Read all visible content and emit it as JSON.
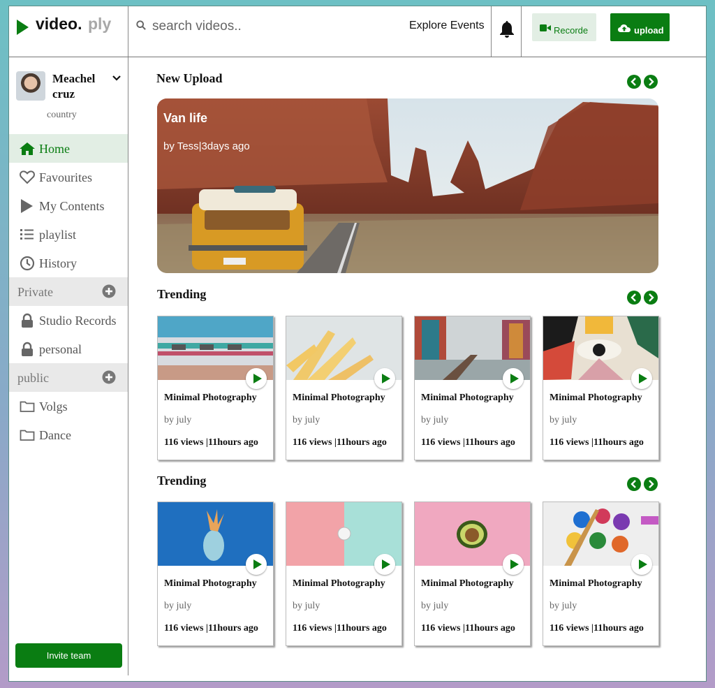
{
  "brand": {
    "name": "video.",
    "suffix": "ply"
  },
  "search": {
    "placeholder": "search videos.."
  },
  "header": {
    "explore_label": "Explore Events",
    "record_label": "Recorde",
    "upload_label": "upload"
  },
  "profile": {
    "name": "Meachel cruz",
    "location": "country"
  },
  "sidebar": {
    "items": [
      {
        "label": "Home",
        "icon": "home-icon"
      },
      {
        "label": "Favourites",
        "icon": "heart-icon"
      },
      {
        "label": "My Contents",
        "icon": "play-icon"
      },
      {
        "label": "playlist",
        "icon": "list-icon"
      },
      {
        "label": "History",
        "icon": "clock-icon"
      }
    ],
    "private_label": "Private",
    "private_items": [
      {
        "label": "Studio Records",
        "icon": "lock-icon"
      },
      {
        "label": "personal",
        "icon": "lock-icon"
      }
    ],
    "public_label": "public",
    "public_items": [
      {
        "label": "Volgs",
        "icon": "folder-icon"
      },
      {
        "label": "Dance",
        "icon": "folder-icon"
      }
    ],
    "invite_label": "Invite team"
  },
  "sections": {
    "new_upload": "New Upload",
    "trending_1": "Trending",
    "trending_2": "Trending"
  },
  "hero": {
    "title": "Van life",
    "subtitle": "by Tess|3days ago"
  },
  "trending_1": [
    {
      "title": "Minimal Photography",
      "by": "by july",
      "meta": "116 views |11hours ago"
    },
    {
      "title": "Minimal Photography",
      "by": "by july",
      "meta": "116 views |11hours ago"
    },
    {
      "title": "Minimal Photography",
      "by": "by july",
      "meta": "116 views |11hours ago"
    },
    {
      "title": "Minimal Photography",
      "by": "by july",
      "meta": "116 views |11hours ago"
    }
  ],
  "trending_2": [
    {
      "title": "Minimal Photography",
      "by": "by july",
      "meta": "116 views |11hours ago"
    },
    {
      "title": "Minimal Photography",
      "by": "by july",
      "meta": "116 views |11hours ago"
    },
    {
      "title": "Minimal Photography",
      "by": "by july",
      "meta": "116 views |11hours ago"
    },
    {
      "title": "Minimal Photography",
      "by": "by july",
      "meta": "116 views |11hours ago"
    }
  ],
  "colors": {
    "accent": "#0a7d12",
    "accent_light": "#e2eee4",
    "section_bg": "#e9e9e9"
  }
}
